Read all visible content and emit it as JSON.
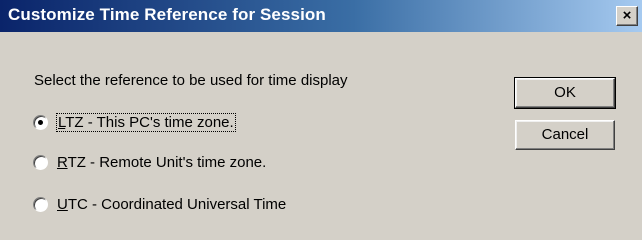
{
  "window": {
    "title": "Customize Time Reference for Session",
    "close_glyph": "×"
  },
  "instruction": "Select the reference to be used for time display",
  "options": [
    {
      "accel": "L",
      "rest": "TZ - This PC's time zone.",
      "selected": true
    },
    {
      "accel": "R",
      "rest": "TZ - Remote Unit's time zone.",
      "selected": false
    },
    {
      "accel": "U",
      "rest": "TC - Coordinated Universal Time",
      "selected": false
    }
  ],
  "buttons": {
    "ok": "OK",
    "cancel": "Cancel"
  }
}
